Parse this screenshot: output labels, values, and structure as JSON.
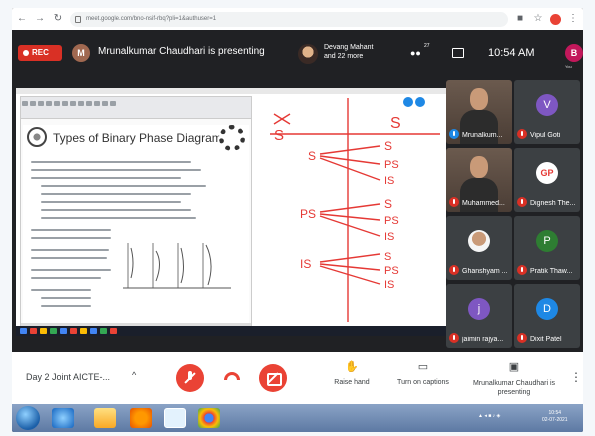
{
  "browser": {
    "url": "meet.google.com/bno-nsif-rbq?pli=1&authuser=1"
  },
  "header": {
    "rec_label": "REC",
    "presenter_initial": "M",
    "presenting_text": "Mrunalkumar Chaudhari is presenting",
    "featured_participant": "Devang Mahant and 22 more",
    "people_count": "27",
    "time": "10:54 AM",
    "you_initial": "B",
    "you_label": "You"
  },
  "slide": {
    "title": "Types of Binary Phase Diagrams"
  },
  "whiteboard": {
    "row1_left": "S",
    "row1_right": "S",
    "row1_targets": [
      "S",
      "PS",
      "IS"
    ],
    "row2_left": "PS",
    "row2_targets": [
      "S",
      "PS",
      "IS"
    ],
    "row3_left": "IS",
    "row3_targets": [
      "PS",
      "IS"
    ]
  },
  "participants": [
    {
      "name": "Mrunalkum...",
      "initial": "",
      "color": "",
      "video": true
    },
    {
      "name": "Vipul Goti",
      "initial": "V",
      "color": "#7e57c2",
      "video": false
    },
    {
      "name": "Muhammed...",
      "initial": "",
      "color": "",
      "video": true
    },
    {
      "name": "Dignesh The...",
      "initial": "GP",
      "color": "#ffffff",
      "video": false
    },
    {
      "name": "Ghanshyam ...",
      "initial": "",
      "color": "#f5f5f5",
      "video": false
    },
    {
      "name": "Pratik Thaw...",
      "initial": "P",
      "color": "#2e7d32",
      "video": false
    },
    {
      "name": "jaimin rajya...",
      "initial": "j",
      "color": "#7e57c2",
      "video": false
    },
    {
      "name": "Dixit Patel",
      "initial": "D",
      "color": "#1e88e5",
      "video": false
    }
  ],
  "controls": {
    "meeting_title": "Day 2 Joint AICTE-...",
    "chevron": "^",
    "raise_hand": "Raise hand",
    "captions": "Turn on captions",
    "present_status": "Mrunalkumar Chaudhari is presenting",
    "more": "⋮"
  },
  "taskbar": {
    "tray_time": "10:54",
    "tray_date": "02-07-2021"
  },
  "colors": {
    "rec": "#d93025",
    "marker": "#e53935",
    "meet_bg": "#202124"
  }
}
